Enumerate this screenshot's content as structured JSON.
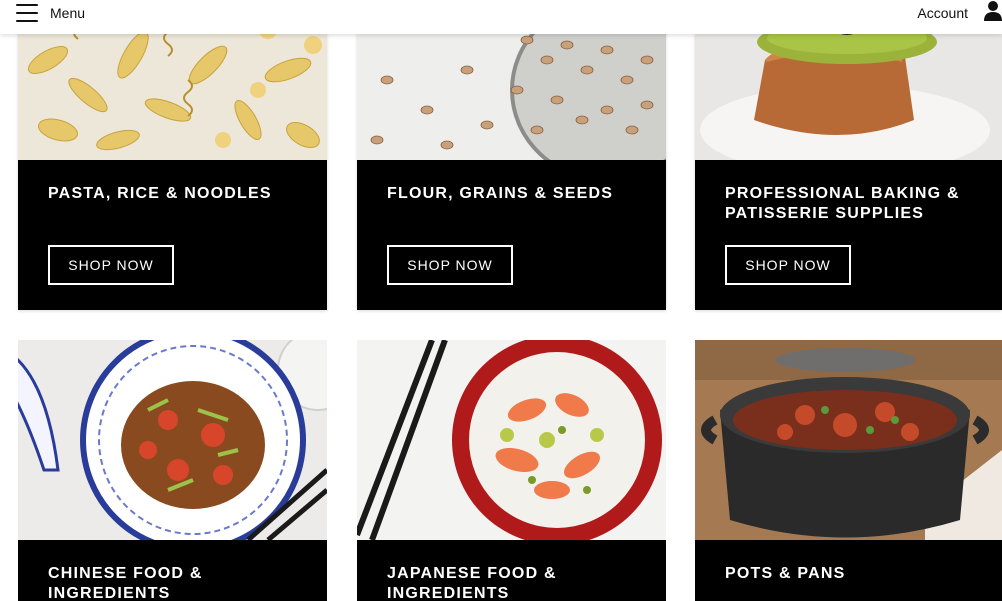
{
  "header": {
    "menu_label": "Menu",
    "account_label": "Account",
    "menu_icon": "hamburger-icon",
    "account_icon": "user-icon"
  },
  "categories": [
    {
      "title": "PASTA, RICE & NOODLES",
      "button": "SHOP NOW",
      "image": "dried pasta shapes"
    },
    {
      "title": "FLOUR, GRAINS & SEEDS",
      "button": "SHOP NOW",
      "image": "dried beans in a metal bowl"
    },
    {
      "title": "PROFESSIONAL BAKING & PATISSERIE SUPPLIES",
      "button": "SHOP NOW",
      "image": "cake topped with pistachio and a cherry"
    },
    {
      "title": "CHINESE FOOD & INGREDIENTS",
      "image": "stir-fry in a blue and white bowl"
    },
    {
      "title": "JAPANESE FOOD & INGREDIENTS",
      "image": "sushi rice bowl with salmon"
    },
    {
      "title": "POTS & PANS",
      "image": "black casserole pot with stew"
    }
  ],
  "colors": {
    "panel": "#000000",
    "text_on_panel": "#ffffff",
    "header_bg": "#ffffff"
  }
}
